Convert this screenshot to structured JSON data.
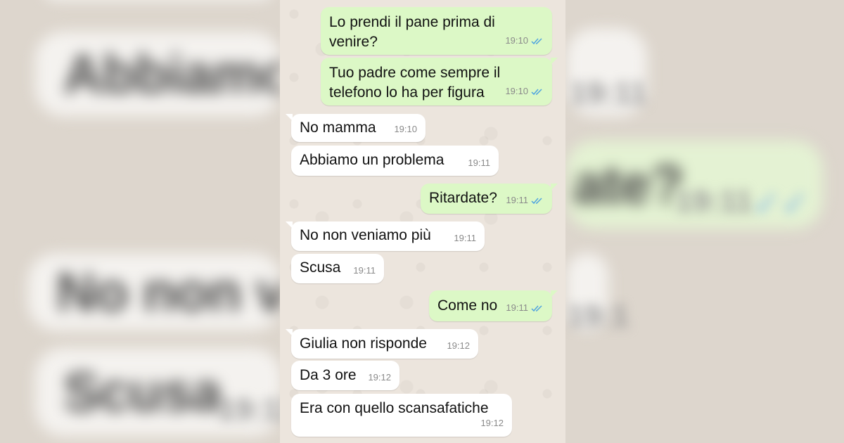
{
  "messages": [
    {
      "dir": "out",
      "text": "Lo prendi il pane prima di venire?",
      "time": "19:10"
    },
    {
      "dir": "out",
      "text": "Tuo padre come sempre il telefono lo ha per figura",
      "time": "19:10"
    },
    {
      "dir": "in",
      "text": "No mamma",
      "time": "19:10"
    },
    {
      "dir": "in",
      "text": "Abbiamo un problema",
      "time": "19:11"
    },
    {
      "dir": "out",
      "text": "Ritardate?",
      "time": "19:11"
    },
    {
      "dir": "in",
      "text": "No non veniamo più",
      "time": "19:11"
    },
    {
      "dir": "in",
      "text": "Scusa",
      "time": "19:11"
    },
    {
      "dir": "out",
      "text": "Come no",
      "time": "19:11"
    },
    {
      "dir": "in",
      "text": "Giulia non risponde",
      "time": "19:12"
    },
    {
      "dir": "in",
      "text": "Da 3 ore",
      "time": "19:12"
    },
    {
      "dir": "in",
      "text": "Era con quello scansafatiche",
      "time": "19:12"
    }
  ],
  "background_blur": {
    "line1": "Abbiamo u",
    "line2": "ate?",
    "line3": "No non ve",
    "line4": "Scusa",
    "time_a": "19:11",
    "time_b": "19:11",
    "time_c": "19:1"
  },
  "colors": {
    "outgoing_bubble": "#dcf8c6",
    "incoming_bubble": "#ffffff",
    "read_ticks": "#4fa3e0",
    "chat_bg": "#ece5dd"
  },
  "icons": {
    "status": "double-check-icon"
  }
}
